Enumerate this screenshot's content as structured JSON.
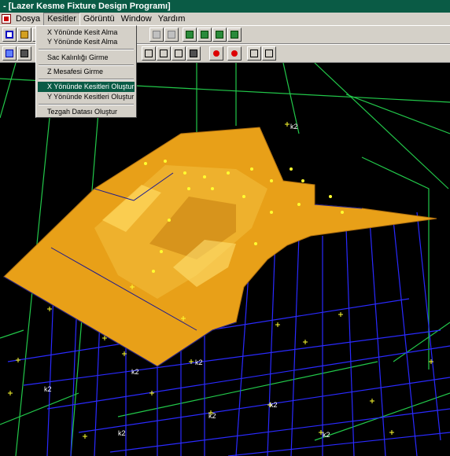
{
  "window": {
    "title": "- [Lazer Kesme Fixture Design Programı]"
  },
  "menubar": {
    "items": [
      "Dosya",
      "Kesitler",
      "Görüntü",
      "Window",
      "Yardım"
    ]
  },
  "dropdown": {
    "items": [
      "X Yönünde Kesit Alma",
      "Y Yönünde Kesit Alma",
      "Sac Kalınlığı Girme",
      "Z Mesafesi Girme",
      "X Yönünde Kesitleri Oluştur",
      "Y Yönünde Kesitleri Oluştur",
      "Tezgah Datası Oluştur"
    ],
    "highlighted_index": 4
  },
  "viewport": {
    "axis_label": "k2"
  },
  "colors": {
    "title_bg": "#0a5b45",
    "surface": "#e8a018",
    "grid_green": "#22c84a",
    "grid_blue": "#2a2aff"
  }
}
